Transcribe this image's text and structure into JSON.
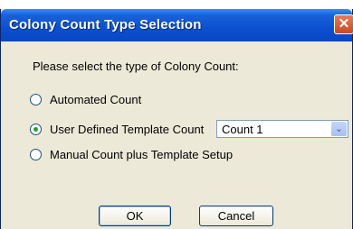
{
  "dialog": {
    "title": "Colony Count Type Selection",
    "close_glyph": "✕",
    "prompt": "Please select the type of Colony Count:"
  },
  "options": [
    {
      "label": "Automated Count",
      "checked": false
    },
    {
      "label": "User Defined Template Count",
      "checked": true
    },
    {
      "label": "Manual Count plus Template Setup",
      "checked": false
    }
  ],
  "template_select": {
    "value": "Count 1",
    "arrow_glyph": "⌄"
  },
  "buttons": {
    "ok": "OK",
    "cancel": "Cancel"
  },
  "colors": {
    "titlebar": "#0b4fd0",
    "dialog_bg": "#ece9d8",
    "radio_check": "#21a121"
  }
}
